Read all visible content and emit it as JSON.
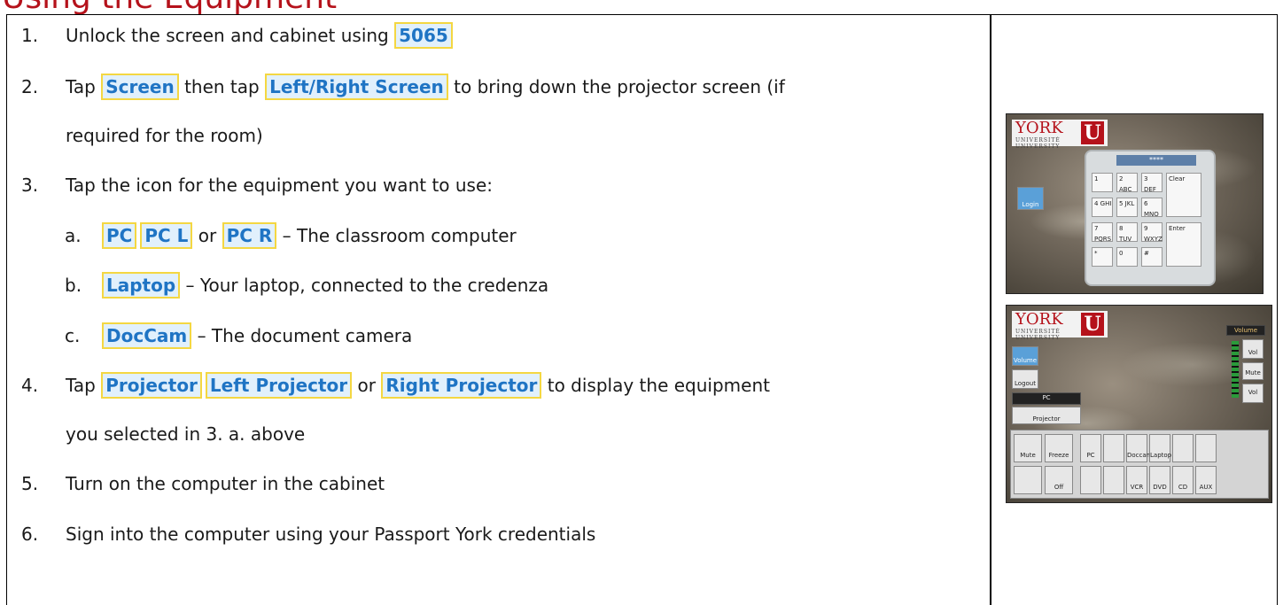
{
  "heading": "Using the Equipment",
  "steps": [
    {
      "num": "1.",
      "pre": "Unlock the screen and cabinet using ",
      "ui": "5065"
    },
    {
      "num": "2.",
      "pre": "Tap ",
      "ui1": "Screen",
      "mid": " then tap ",
      "ui2": "Left/Right Screen",
      "post": " to bring down the projector screen (if",
      "cont": "required for the room)"
    },
    {
      "num": "3.",
      "text": "Tap the icon for the equipment you want to use:"
    },
    {
      "num": "4.",
      "pre": "Tap ",
      "ui1": "Projector",
      "ui2": "Left Projector",
      "mid": " or ",
      "ui3": "Right Projector ",
      "post": " to display the equipment",
      "cont": "you selected in 3. a. above"
    },
    {
      "num": "5.",
      "text": "Turn on the computer in the cabinet"
    },
    {
      "num": "6.",
      "text": "Sign into the computer using your Passport York credentials"
    }
  ],
  "substeps": [
    {
      "num": "a.",
      "ui1": "PC",
      "ui2": "PC L",
      "mid": " or ",
      "ui3": "PC R",
      "post": " – The classroom computer"
    },
    {
      "num": "b.",
      "ui": "Laptop",
      "post": " – Your laptop, connected to the credenza"
    },
    {
      "num": "c.",
      "ui": "DocCam",
      "post": " – The document camera"
    }
  ],
  "photo_login": {
    "logo": "YORK",
    "logo_sub": "UNIVERSITÉ UNIVERSITY",
    "logo_u": "U",
    "display": "****",
    "login_btn": "Login",
    "keys": [
      "1",
      "2 ABC",
      "3 DEF",
      "Clear",
      "4 GHI",
      "5 JKL",
      "6 MNO",
      "7 PQRS",
      "8 TUV",
      "9 WXYZ",
      "Enter",
      "*",
      "0",
      "#"
    ]
  },
  "photo_control": {
    "logo": "YORK",
    "logo_sub": "UNIVERSITÉ UNIVERSITY",
    "logo_u": "U",
    "volume_btn": "Volume",
    "logout_btn": "Logout",
    "pc_label": "PC",
    "projector_btn": "Projector",
    "volume_title": "Volume",
    "vol_up": "Vol",
    "mute_right": "Mute",
    "vol_down": "Vol",
    "row1": [
      "Mute",
      "Freeze",
      "PC",
      "",
      "Doccam",
      "Laptop",
      "",
      ""
    ],
    "row2": [
      "",
      "Off",
      "",
      "",
      "VCR",
      "DVD",
      "CD",
      "AUX"
    ]
  }
}
